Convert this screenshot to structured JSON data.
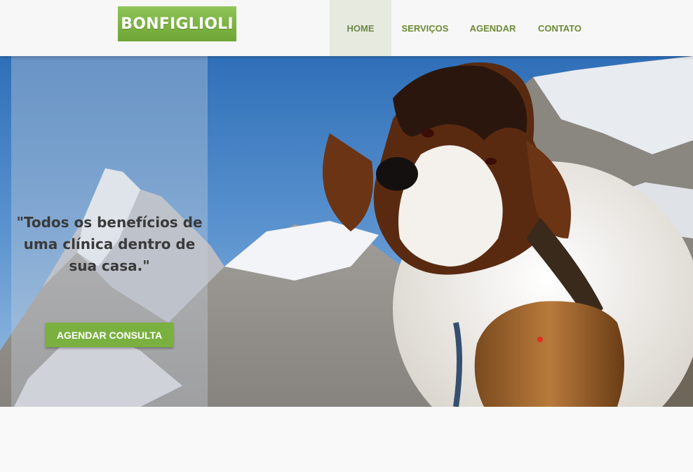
{
  "header": {
    "logo_text": "BONFIGLIOLI",
    "nav": [
      {
        "label": "HOME",
        "active": true
      },
      {
        "label": "SERVIÇOS",
        "active": false
      },
      {
        "label": "AGENDAR",
        "active": false
      },
      {
        "label": "CONTATO",
        "active": false
      }
    ]
  },
  "hero": {
    "quote": "\"Todos os benefícios de uma clínica dentro de sua casa.\"",
    "cta_label": "AGENDAR CONSULTA",
    "image_subject": "saint-bernard-dog-with-barrel-in-mountains"
  },
  "colors": {
    "brand_green": "#7ab040",
    "nav_text": "#6d8b36",
    "nav_active_bg": "#e6eadf",
    "header_bg": "#f7f7f7"
  }
}
